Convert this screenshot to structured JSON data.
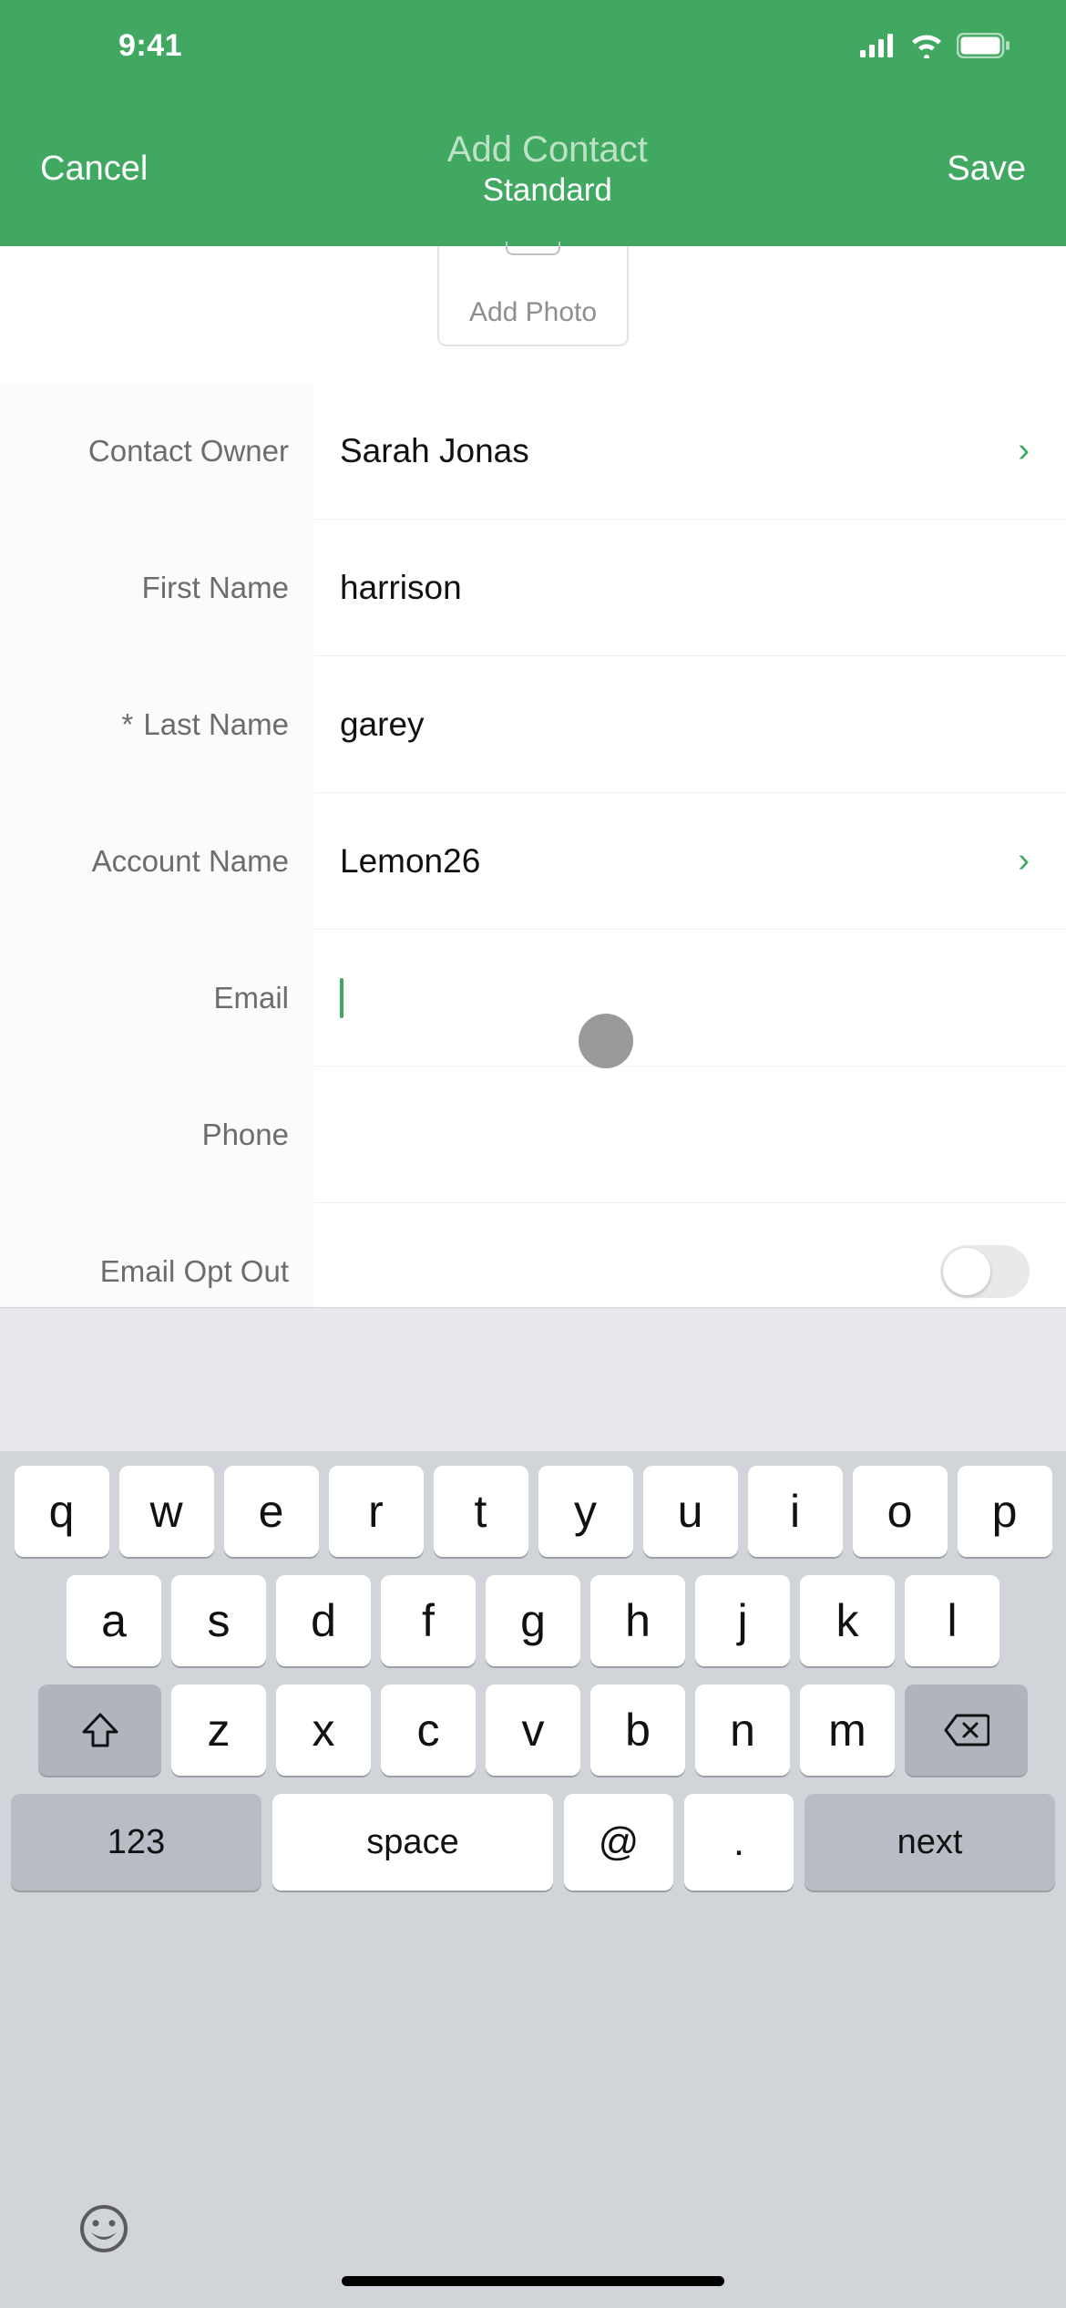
{
  "status": {
    "time": "9:41"
  },
  "nav": {
    "cancel": "Cancel",
    "title": "Add Contact",
    "subtitle": "Standard",
    "save": "Save"
  },
  "addPhoto": {
    "label": "Add Photo"
  },
  "fields": {
    "contactOwner": {
      "label": "Contact Owner",
      "value": "Sarah Jonas"
    },
    "firstName": {
      "label": "First Name",
      "value": "harrison"
    },
    "lastName": {
      "label": "Last Name",
      "value": "garey",
      "required": true
    },
    "accountName": {
      "label": "Account Name",
      "value": "Lemon26"
    },
    "email": {
      "label": "Email",
      "value": ""
    },
    "phone": {
      "label": "Phone",
      "value": ""
    },
    "emailOptOut": {
      "label": "Email Opt Out",
      "value": false
    }
  },
  "keyboard": {
    "row1": [
      "q",
      "w",
      "e",
      "r",
      "t",
      "y",
      "u",
      "i",
      "o",
      "p"
    ],
    "row2": [
      "a",
      "s",
      "d",
      "f",
      "g",
      "h",
      "j",
      "k",
      "l"
    ],
    "row3": [
      "z",
      "x",
      "c",
      "v",
      "b",
      "n",
      "m"
    ],
    "numKey": "123",
    "spaceKey": "space",
    "atKey": "@",
    "dotKey": ".",
    "nextKey": "next"
  }
}
